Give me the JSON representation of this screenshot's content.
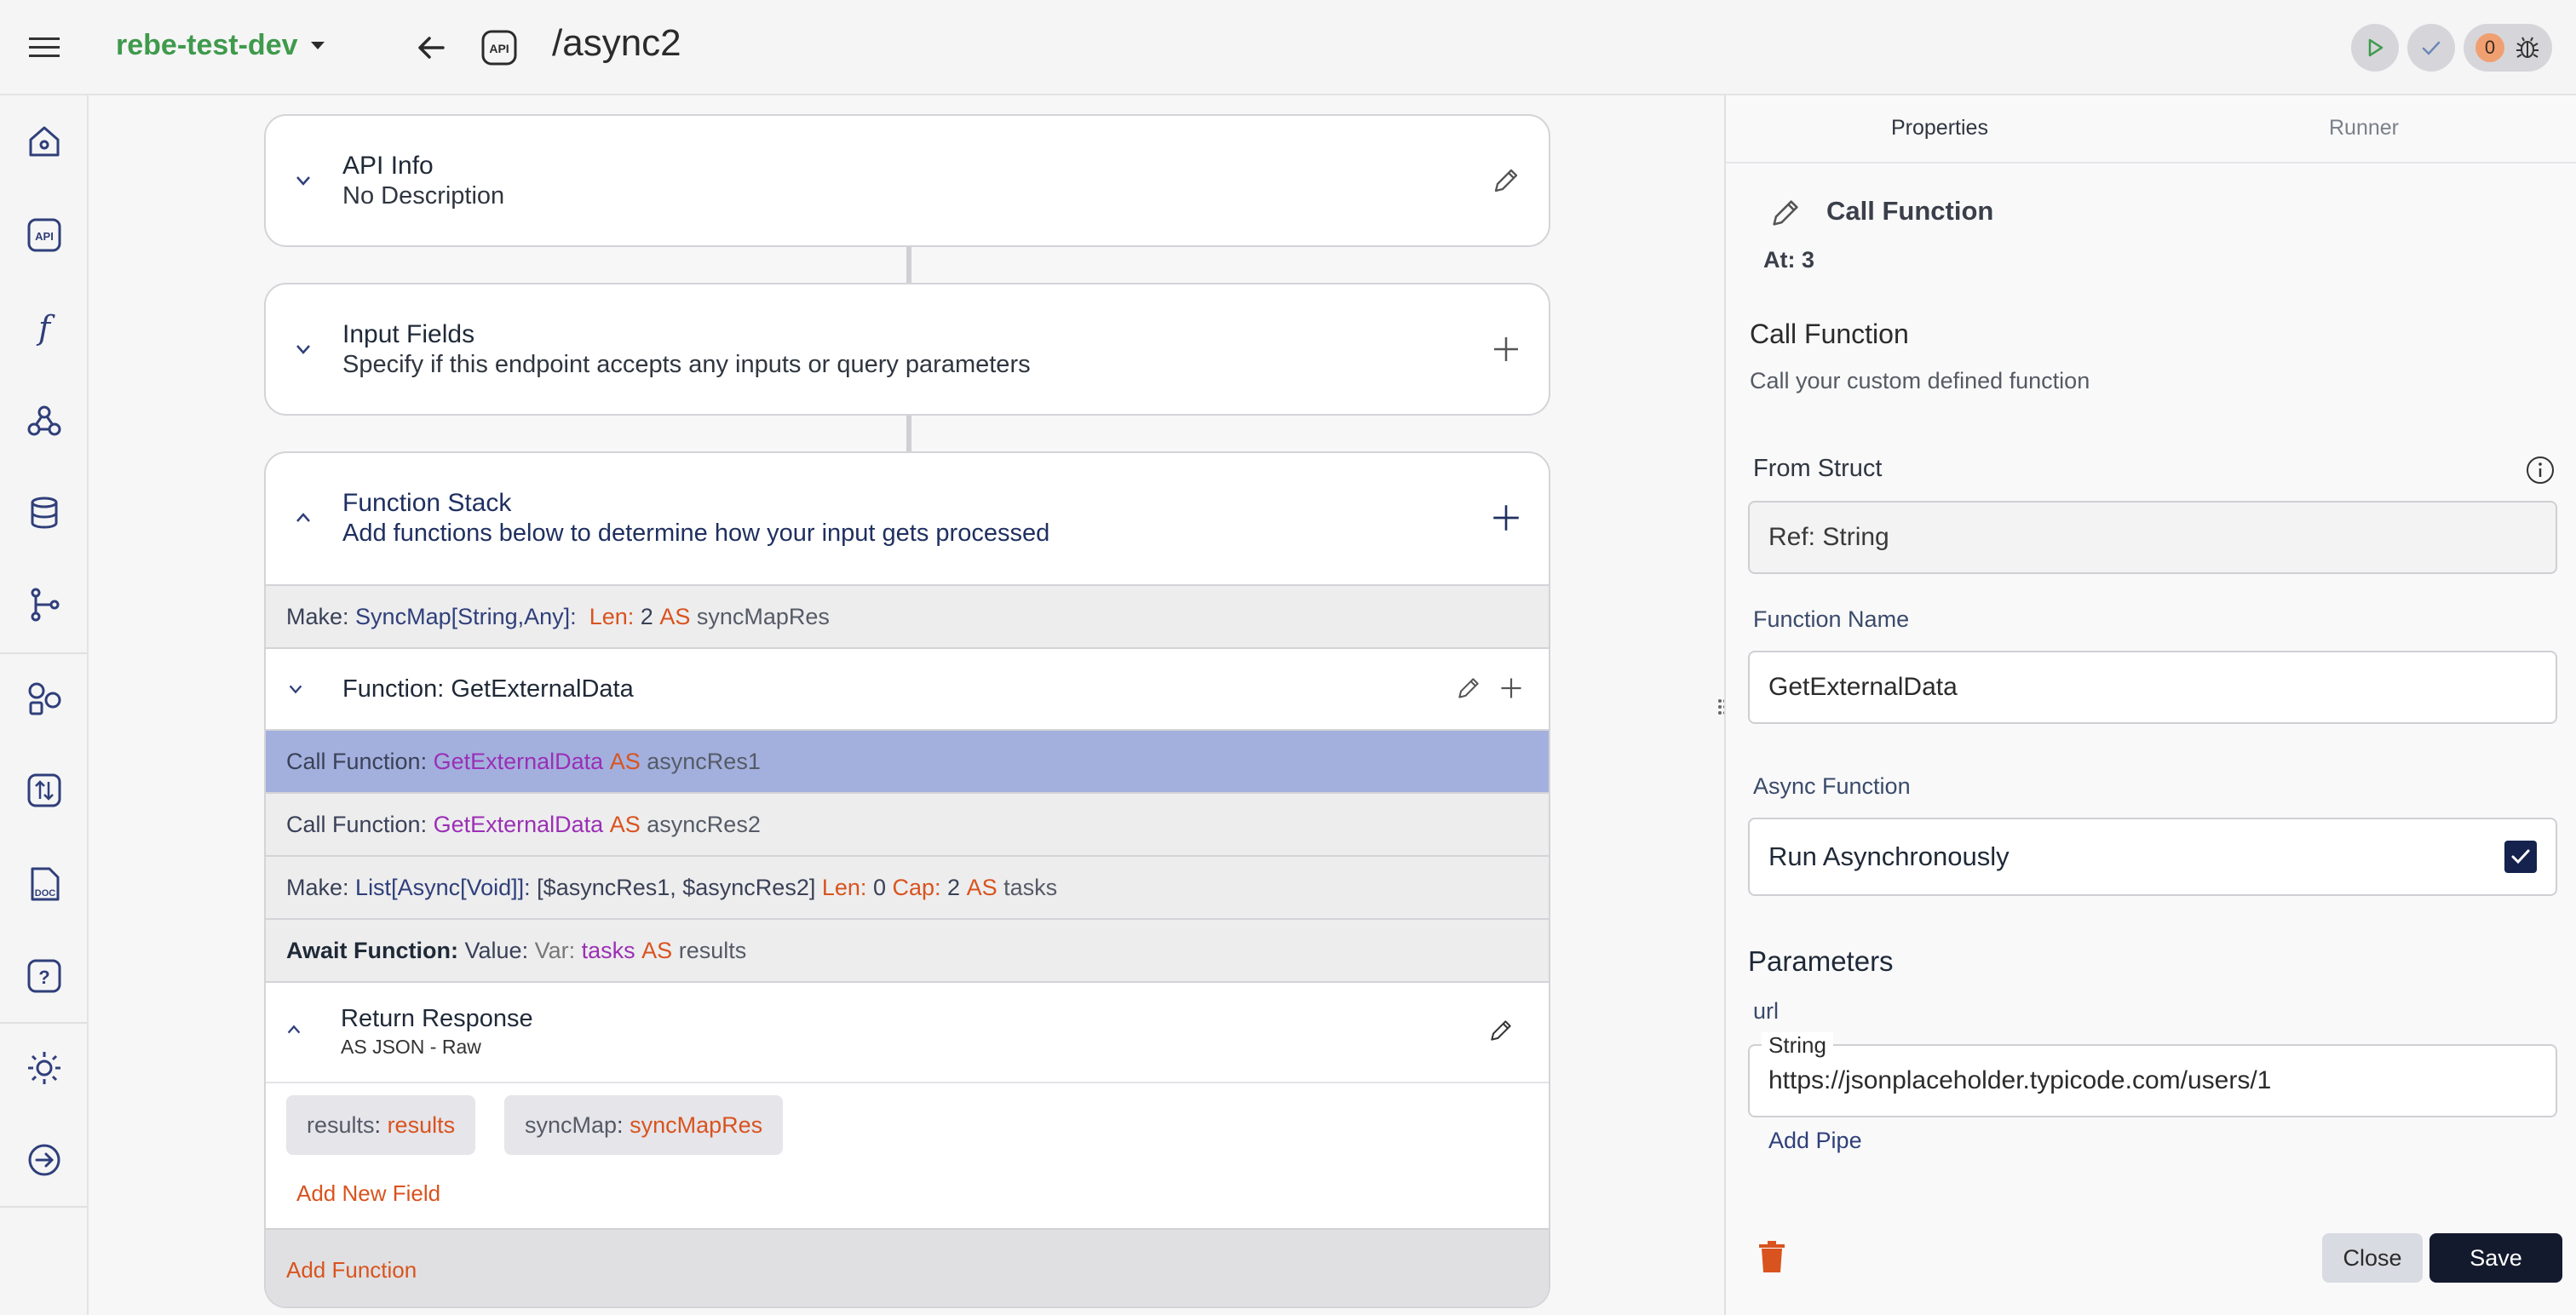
{
  "header": {
    "project_name": "rebe-test-dev",
    "route": "/async2",
    "api_chip_label": "API",
    "issue_count": "0"
  },
  "canvas": {
    "api_info": {
      "title": "API Info",
      "subtitle": "No Description"
    },
    "input_fields": {
      "title": "Input Fields",
      "subtitle": "Specify if this endpoint accepts any inputs or query parameters"
    },
    "function_stack": {
      "title": "Function Stack",
      "subtitle": "Add functions below to determine how your input gets processed",
      "rows": {
        "make1": {
          "prefix": "Make:",
          "type": "SyncMap[String,Any]:",
          "len_kw": "Len:",
          "len_val": "2",
          "as_kw": "AS",
          "var": "syncMapRes"
        },
        "function_group": {
          "label": "Function: GetExternalData"
        },
        "call1": {
          "prefix": "Call Function:",
          "fn": "GetExternalData",
          "as_kw": "AS",
          "var": "asyncRes1"
        },
        "call2": {
          "prefix": "Call Function:",
          "fn": "GetExternalData",
          "as_kw": "AS",
          "var": "asyncRes2"
        },
        "make2": {
          "prefix": "Make:",
          "type": "List[Async[Void]]:",
          "value": "[$asyncRes1, $asyncRes2]",
          "len_kw": "Len:",
          "len_val": "0",
          "cap_kw": "Cap:",
          "cap_val": "2",
          "as_kw": "AS",
          "var": "tasks"
        },
        "await": {
          "prefix": "Await Function:",
          "value_kw": "Value:",
          "var_kw": "Var:",
          "var_val": "tasks",
          "as_kw": "AS",
          "var": "results"
        }
      },
      "return_response": {
        "title": "Return Response",
        "subtitle": "AS JSON - Raw",
        "fields": [
          {
            "key": "results",
            "sep": ":",
            "value": "results"
          },
          {
            "key": "syncMap",
            "sep": ":",
            "value": "syncMapRes"
          }
        ],
        "add_field_label": "Add New Field"
      },
      "add_function_label": "Add Function"
    }
  },
  "panel": {
    "tabs": [
      "Properties",
      "Runner"
    ],
    "header_title": "Call Function",
    "at_label": "At: 3",
    "section_title": "Call Function",
    "section_desc": "Call your custom defined function",
    "from_struct": {
      "label": "From Struct",
      "value": "Ref: String"
    },
    "function_name": {
      "label": "Function Name",
      "value": "GetExternalData"
    },
    "async_function": {
      "label": "Async Function",
      "option": "Run Asynchronously",
      "checked": true
    },
    "parameters": {
      "title": "Parameters",
      "param_name": "url",
      "param_type": "String",
      "param_value": "https://jsonplaceholder.typicode.com/users/1",
      "add_pipe": "Add Pipe"
    },
    "close_label": "Close",
    "save_label": "Save"
  },
  "colors": {
    "accent_green": "#3f9a4c",
    "selected_row": "#a3b0de",
    "keyword_orange": "#d9531e",
    "function_purple": "#9b2fb5",
    "save_dark": "#141a2e"
  }
}
